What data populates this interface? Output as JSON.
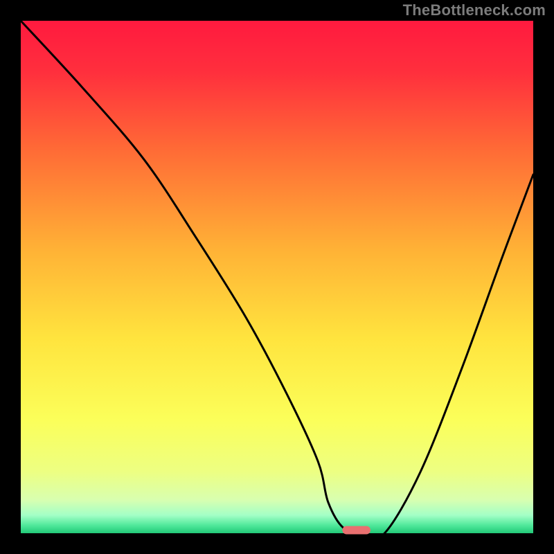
{
  "watermark": {
    "text": "TheBottleneck.com"
  },
  "chart_data": {
    "type": "line",
    "title": "",
    "xlabel": "",
    "ylabel": "",
    "xlim": [
      0,
      100
    ],
    "ylim": [
      0,
      100
    ],
    "grid": false,
    "legend": false,
    "background_gradient": {
      "orientation": "vertical",
      "stops": [
        {
          "offset": 0.0,
          "color": "#ff1a3f"
        },
        {
          "offset": 0.1,
          "color": "#ff2f3d"
        },
        {
          "offset": 0.25,
          "color": "#ff6a36"
        },
        {
          "offset": 0.45,
          "color": "#ffb336"
        },
        {
          "offset": 0.62,
          "color": "#ffe43e"
        },
        {
          "offset": 0.78,
          "color": "#fbff5a"
        },
        {
          "offset": 0.88,
          "color": "#edff82"
        },
        {
          "offset": 0.935,
          "color": "#d8ffb0"
        },
        {
          "offset": 0.965,
          "color": "#a3ffc6"
        },
        {
          "offset": 0.985,
          "color": "#4fe89a"
        },
        {
          "offset": 1.0,
          "color": "#22c877"
        }
      ]
    },
    "series": [
      {
        "name": "bottleneck-curve",
        "color": "#000000",
        "x": [
          0,
          12,
          24,
          34,
          44,
          52,
          58,
          60,
          63,
          67,
          71,
          78,
          86,
          94,
          100
        ],
        "y": [
          100,
          87,
          73,
          58,
          42,
          27,
          14,
          6,
          1,
          0,
          0,
          12,
          32,
          54,
          70
        ]
      }
    ],
    "marker": {
      "name": "optimal-point",
      "color": "#e97070",
      "x_center": 65.5,
      "y_center": 0.6,
      "width": 5.5,
      "height": 1.6
    }
  }
}
